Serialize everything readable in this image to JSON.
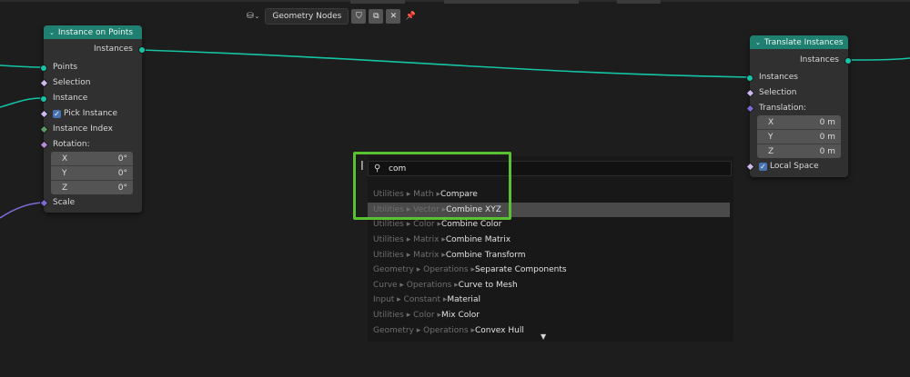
{
  "header": {
    "editor_icon": "node-editor-icon",
    "tree_name": "Geometry Nodes"
  },
  "node_instance_on_points": {
    "title": "Instance on Points",
    "output": "Instances",
    "inputs": {
      "points": "Points",
      "selection": "Selection",
      "instance": "Instance",
      "pick_instance": "Pick Instance",
      "instance_index": "Instance Index",
      "rotation": "Rotation:",
      "scale": "Scale"
    },
    "rotation_values": [
      {
        "axis": "X",
        "value": "0°"
      },
      {
        "axis": "Y",
        "value": "0°"
      },
      {
        "axis": "Z",
        "value": "0°"
      }
    ]
  },
  "node_translate_instances": {
    "title": "Translate Instances",
    "output": "Instances",
    "inputs": {
      "instances": "Instances",
      "selection": "Selection",
      "translation": "Translation:",
      "local_space": "Local Space"
    },
    "translation_values": [
      {
        "axis": "X",
        "value": "0 m"
      },
      {
        "axis": "Y",
        "value": "0 m"
      },
      {
        "axis": "Z",
        "value": "0 m"
      }
    ]
  },
  "search": {
    "query": "com",
    "results": [
      {
        "path": "Utilities ▸ Math ▸ ",
        "name": "Compare"
      },
      {
        "path": "Utilities ▸ Vector ▸ ",
        "name": "Combine XYZ"
      },
      {
        "path": "Utilities ▸ Color ▸ ",
        "name": "Combine Color"
      },
      {
        "path": "Utilities ▸ Matrix ▸ ",
        "name": "Combine Matrix"
      },
      {
        "path": "Utilities ▸ Matrix ▸ ",
        "name": "Combine Transform"
      },
      {
        "path": "Geometry ▸ Operations ▸ ",
        "name": "Separate Components"
      },
      {
        "path": "Curve ▸ Operations ▸ ",
        "name": "Curve to Mesh"
      },
      {
        "path": "Input ▸ Constant ▸ ",
        "name": "Material"
      },
      {
        "path": "Utilities ▸ Color ▸ ",
        "name": "Mix Color"
      },
      {
        "path": "Geometry ▸ Operations ▸ ",
        "name": "Convex Hull"
      }
    ],
    "active_index": 1
  },
  "colors": {
    "geometry_link": "#14c4a6",
    "vector_link": "#7a6cd6",
    "node_header": "#1f7f70",
    "highlight": "#58c232"
  }
}
